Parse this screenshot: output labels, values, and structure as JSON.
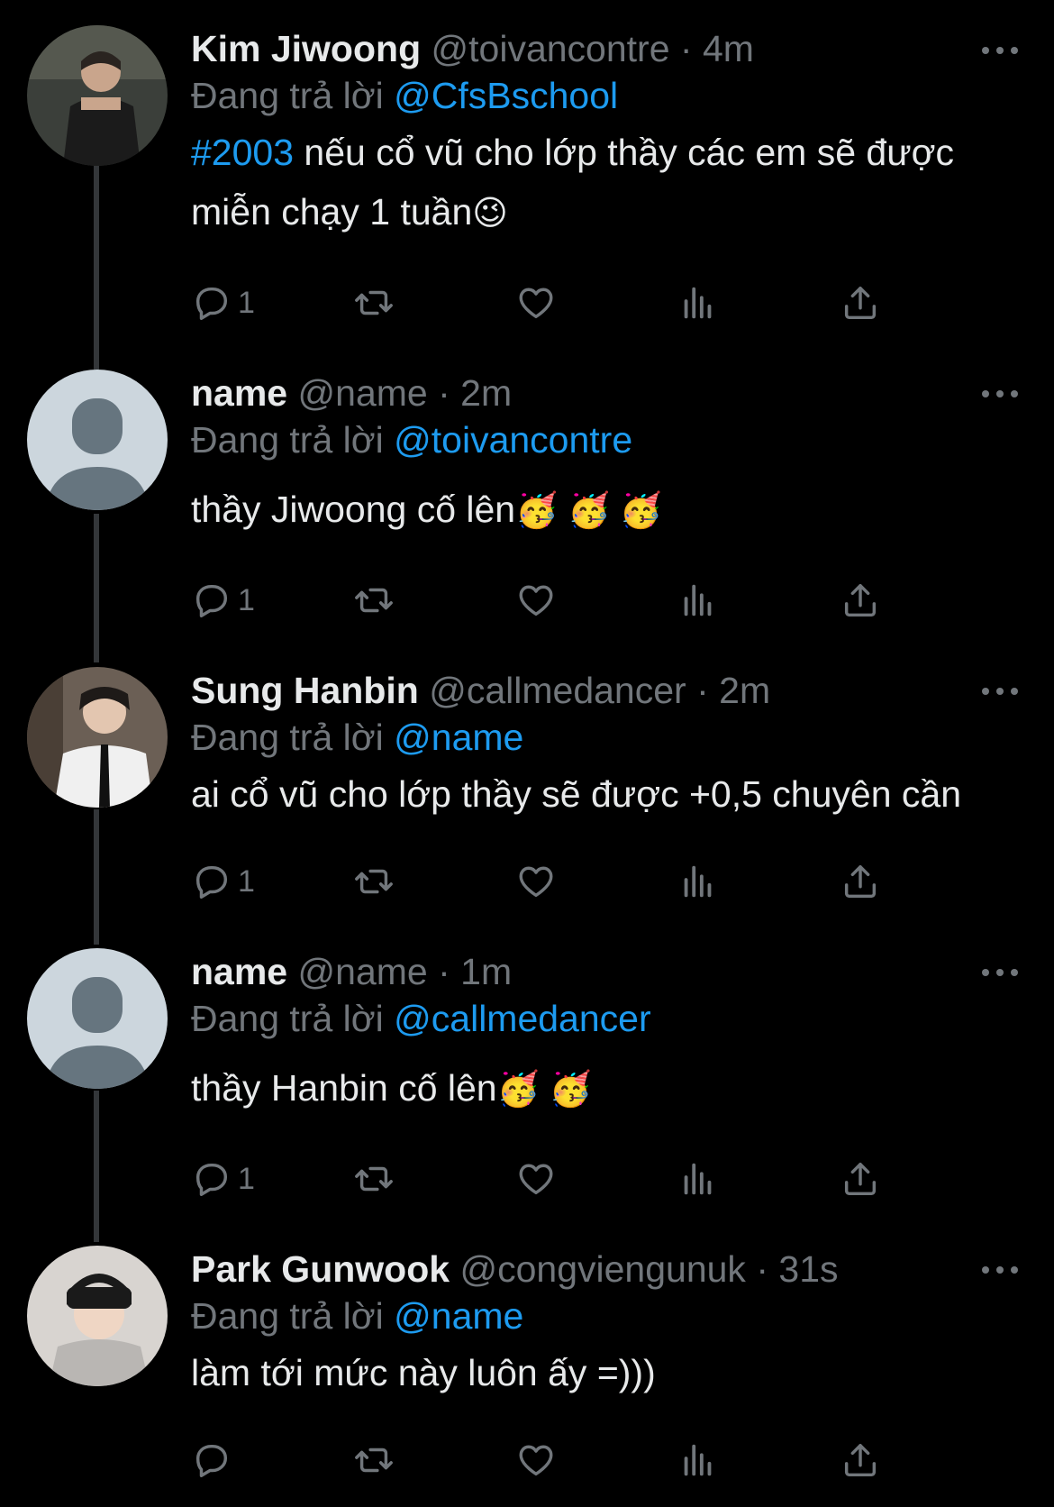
{
  "reply_prefix": "Đang trả lời",
  "colors": {
    "background": "#000000",
    "text": "#e7e9ea",
    "muted": "#71767b",
    "link": "#1d9bf0",
    "thread_line": "#333639"
  },
  "action_icons": [
    "reply-icon",
    "retweet-icon",
    "like-icon",
    "views-icon",
    "share-icon"
  ],
  "tweets": [
    {
      "name": "Kim Jiwoong",
      "handle": "@toivancontre",
      "time": "4m",
      "replying_to": "@CfsBschool",
      "hashtag": "#2003",
      "text": " nếu cổ vũ cho lớp thầy các em sẽ được miễn chạy 1 tuần",
      "emoji": "😉",
      "reply_count": "1"
    },
    {
      "name": "name",
      "handle": "@name",
      "time": "2m",
      "replying_to": "@toivancontre",
      "text": "thầy Jiwoong cố lên",
      "emoji": "🥳 🥳 🥳",
      "reply_count": "1"
    },
    {
      "name": "Sung Hanbin",
      "handle": "@callmedancer",
      "time": "2m",
      "replying_to": "@name",
      "text": "ai cổ vũ cho lớp thầy sẽ được +0,5 chuyên cần",
      "reply_count": "1"
    },
    {
      "name": "name",
      "handle": "@name",
      "time": "1m",
      "replying_to": "@callmedancer",
      "text": "thầy Hanbin cố lên",
      "emoji": "🥳 🥳",
      "reply_count": "1"
    },
    {
      "name": "Park Gunwook",
      "handle": "@congviengunuk",
      "time": "31s",
      "replying_to": "@name",
      "text": "làm tới mức này luôn ấy =)))",
      "reply_count": ""
    }
  ]
}
